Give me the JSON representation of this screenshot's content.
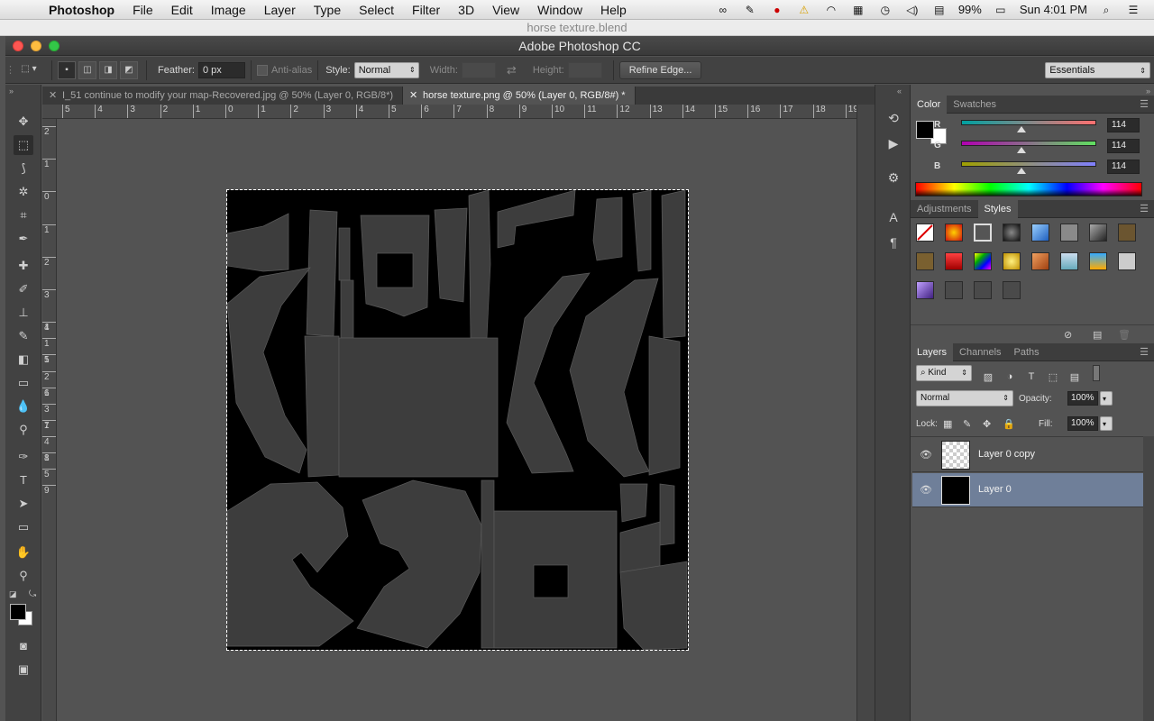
{
  "menubar": {
    "app": "Photoshop",
    "items": [
      "File",
      "Edit",
      "Image",
      "Layer",
      "Type",
      "Select",
      "Filter",
      "3D",
      "View",
      "Window",
      "Help"
    ],
    "battery": "99%",
    "clock": "Sun 4:01 PM"
  },
  "background_window_title": "horse texture.blend",
  "window_title": "Adobe Photoshop CC",
  "options": {
    "feather_label": "Feather:",
    "feather_value": "0 px",
    "antialias_label": "Anti-alias",
    "style_label": "Style:",
    "style_value": "Normal",
    "width_label": "Width:",
    "height_label": "Height:",
    "refine_edge": "Refine Edge...",
    "workspace": "Essentials"
  },
  "tabs": [
    {
      "label": "I_51 continue to modify your map-Recovered.jpg @ 50% (Layer 0, RGB/8*)",
      "active": false
    },
    {
      "label": "horse texture.png @ 50% (Layer 0, RGB/8#) *",
      "active": true
    }
  ],
  "hruler_ticks": [
    "5",
    "4",
    "3",
    "2",
    "1",
    "0",
    "1",
    "2",
    "3",
    "4",
    "5",
    "6",
    "7",
    "8",
    "9",
    "10",
    "11",
    "12",
    "13",
    "14",
    "15",
    "16",
    "17",
    "18",
    "19"
  ],
  "vruler_ticks": [
    "2",
    "1",
    "0",
    "1",
    "2",
    "3",
    "4",
    "5",
    "6",
    "7",
    "8",
    "9",
    "1",
    "1",
    "1",
    "2",
    "1",
    "3",
    "1",
    "4",
    "1",
    "5"
  ],
  "color_panel": {
    "tabs": [
      "Color",
      "Swatches"
    ],
    "r_label": "R",
    "r": "114",
    "g_label": "G",
    "g": "114",
    "b_label": "B",
    "b": "114"
  },
  "styles_panel": {
    "tabs": [
      "Adjustments",
      "Styles"
    ]
  },
  "layers_panel": {
    "tabs": [
      "Layers",
      "Channels",
      "Paths"
    ],
    "kind": "Kind",
    "blend_mode": "Normal",
    "opacity_label": "Opacity:",
    "opacity": "100%",
    "lock_label": "Lock:",
    "fill_label": "Fill:",
    "fill": "100%",
    "layers": [
      {
        "name": "Layer 0 copy",
        "selected": false
      },
      {
        "name": "Layer 0",
        "selected": true
      }
    ]
  },
  "colors": {
    "foreground": "#000000",
    "background": "#ffffff",
    "selected_layer": "#6f7f99",
    "uv_fill": "#3d3d3d"
  }
}
